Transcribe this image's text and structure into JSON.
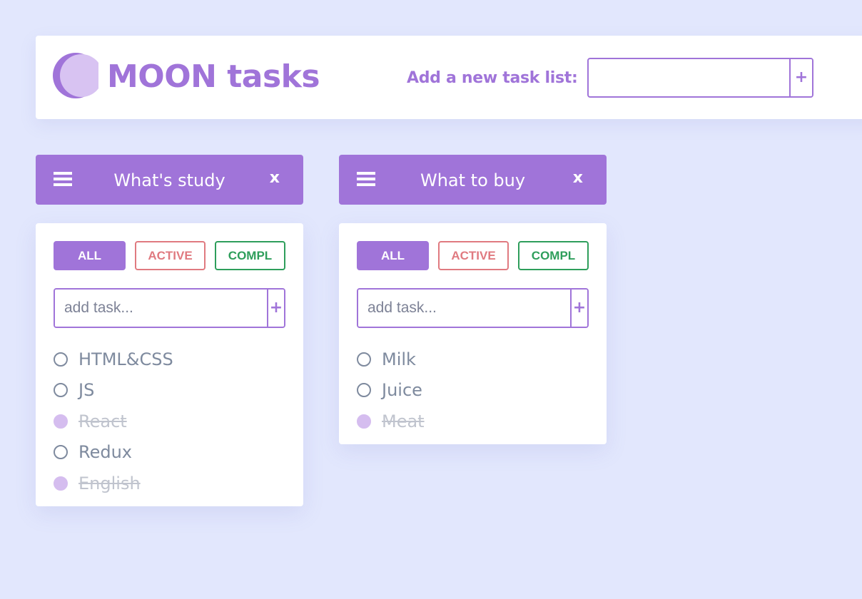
{
  "header": {
    "logo_word": "MOON",
    "logo_rest": "tasks",
    "add_list_label": "Add a new task list:",
    "add_list_value": "",
    "add_button": "+"
  },
  "colors": {
    "accent": "#a074d9",
    "active": "#e07a80",
    "completed": "#2e9e5b",
    "background": "#e2e7fd"
  },
  "lists": [
    {
      "title": "What's study",
      "close": "x",
      "filters": [
        "ALL",
        "ACTIVE",
        "COMPL"
      ],
      "selected_filter": "ALL",
      "add_placeholder": "add task...",
      "add_button": "+",
      "tasks": [
        {
          "text": "HTML&CSS",
          "done": false
        },
        {
          "text": "JS",
          "done": false
        },
        {
          "text": "React",
          "done": true
        },
        {
          "text": "Redux",
          "done": false
        },
        {
          "text": "English",
          "done": true
        }
      ]
    },
    {
      "title": "What to buy",
      "close": "x",
      "filters": [
        "ALL",
        "ACTIVE",
        "COMPL"
      ],
      "selected_filter": "ALL",
      "add_placeholder": "add task...",
      "add_button": "+",
      "tasks": [
        {
          "text": "Milk",
          "done": false
        },
        {
          "text": "Juice",
          "done": false
        },
        {
          "text": "Meat",
          "done": true
        }
      ]
    }
  ]
}
